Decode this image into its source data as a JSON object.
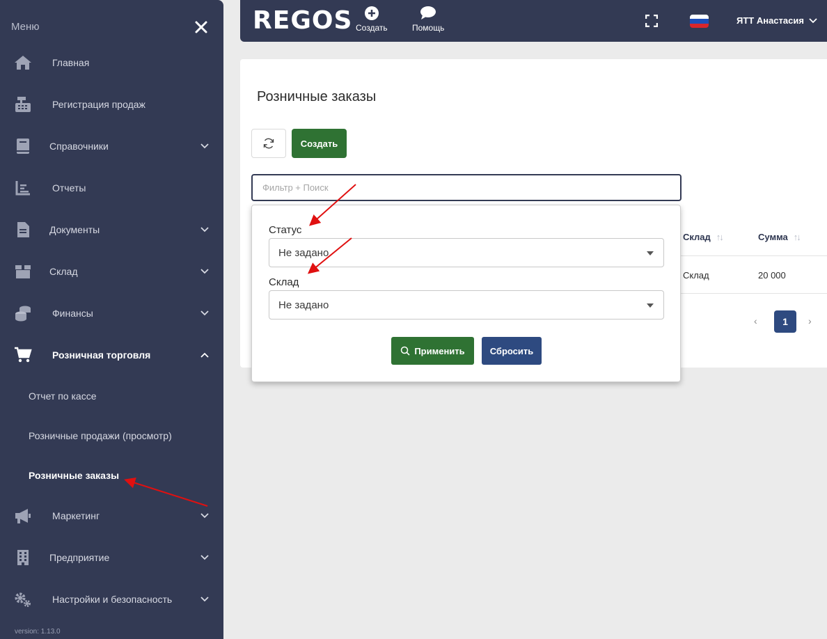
{
  "sidebar": {
    "header": "Меню",
    "items": [
      {
        "label": "Главная"
      },
      {
        "label": "Регистрация продаж"
      },
      {
        "label": "Справочники"
      },
      {
        "label": "Отчеты"
      },
      {
        "label": "Документы"
      },
      {
        "label": "Склад"
      },
      {
        "label": "Финансы"
      },
      {
        "label": "Розничная торговля"
      },
      {
        "label": "Маркетинг"
      },
      {
        "label": "Предприятие"
      },
      {
        "label": "Настройки и безопасность"
      }
    ],
    "sub_items": [
      {
        "label": "Отчет по кассе"
      },
      {
        "label": "Розничные продажи (просмотр)"
      },
      {
        "label": "Розничные заказы"
      }
    ],
    "version": "version: 1.13.0"
  },
  "topbar": {
    "logo": "REGOS",
    "create_label": "Создать",
    "help_label": "Помощь",
    "user_name": "ЯТТ Анастасия"
  },
  "main": {
    "title": "Розничные заказы",
    "create_button": "Создать",
    "search_placeholder": "Фильтр + Поиск",
    "table": {
      "columns": [
        "Склад",
        "Сумма"
      ],
      "rows": [
        [
          "Склад",
          "20 000"
        ]
      ]
    },
    "pagination": {
      "current": "1"
    }
  },
  "filter": {
    "status_label": "Статус",
    "status_value": "Не задано",
    "warehouse_label": "Склад",
    "warehouse_value": "Не задано",
    "apply_button": "Применить",
    "reset_button": "Сбросить"
  },
  "colors": {
    "sidebar_bg": "#333a54",
    "primary_green": "#2f7233",
    "primary_blue": "#2e4a80",
    "annotation_red": "#e01010"
  }
}
